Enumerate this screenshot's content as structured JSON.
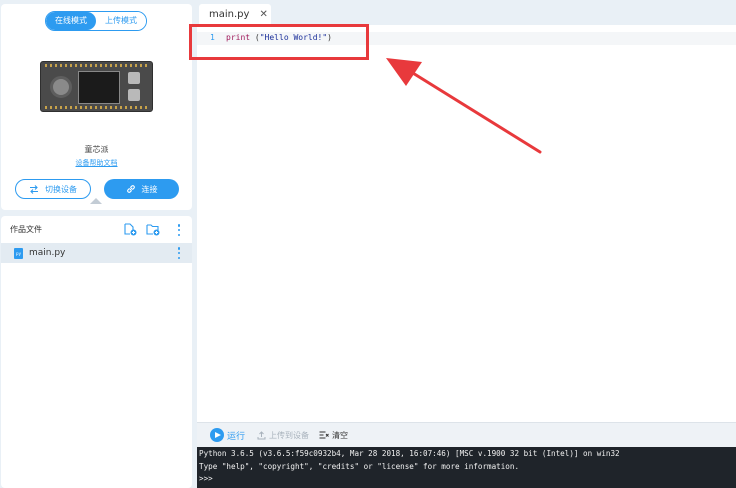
{
  "device_panel": {
    "mode_online": "在线模式",
    "mode_upload": "上传模式",
    "device_name": "童芯派",
    "help_link": "设备帮助文档",
    "switch_device_label": "切换设备",
    "connect_label": "连接"
  },
  "files_panel": {
    "title": "作品文件",
    "files": [
      {
        "name": "main.py",
        "badge": "py"
      }
    ]
  },
  "editor": {
    "tab_label": "main.py",
    "tab_close": "✕",
    "line_number": "1",
    "code": {
      "keyword": "print",
      "open": " (",
      "string": "\"Hello World!\"",
      "close": ")"
    }
  },
  "run_bar": {
    "run_label": "运行",
    "upload_label": "上传到设备",
    "clear_label": "清空"
  },
  "console": {
    "lines": [
      "Python 3.6.5 (v3.6.5:f59c0932b4, Mar 28 2018, 16:07:46) [MSC v.1900 32 bit (Intel)] on win32",
      "Type \"help\", \"copyright\", \"credits\" or \"license\" for more information.",
      ">>>"
    ]
  },
  "colors": {
    "accent": "#2d9bf0",
    "annotation": "#e8393c",
    "console_bg": "#1f242a"
  }
}
